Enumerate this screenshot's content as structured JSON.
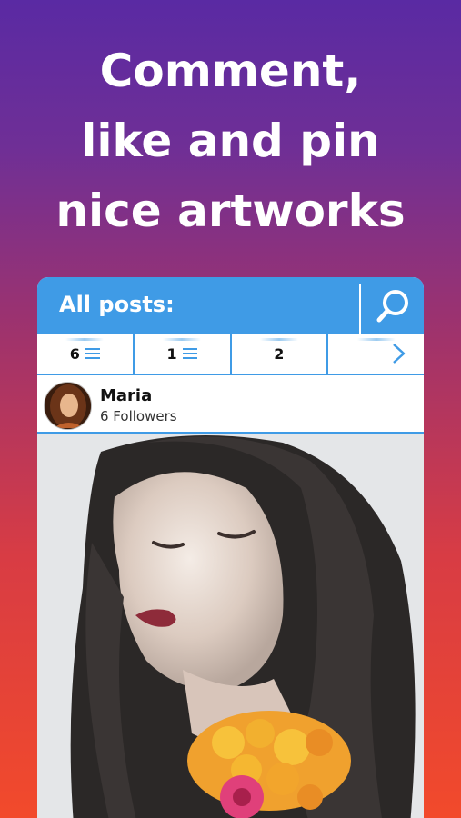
{
  "headline": {
    "line1": "Comment,",
    "line2": "like and pin",
    "line3": "nice artworks"
  },
  "app_bar": {
    "title": "All posts:",
    "search_icon": "search-icon"
  },
  "tabs": [
    {
      "label": "6",
      "icon": "list-icon"
    },
    {
      "label": "1",
      "icon": "list-icon"
    },
    {
      "label": "2",
      "icon": ""
    },
    {
      "label": "",
      "icon": "arrow-right-icon"
    }
  ],
  "post": {
    "author": "Maria",
    "followers": "6 Followers"
  },
  "colors": {
    "accent": "#3f9be6",
    "bg_top": "#5a2aa3",
    "bg_bottom": "#f24a2b"
  }
}
